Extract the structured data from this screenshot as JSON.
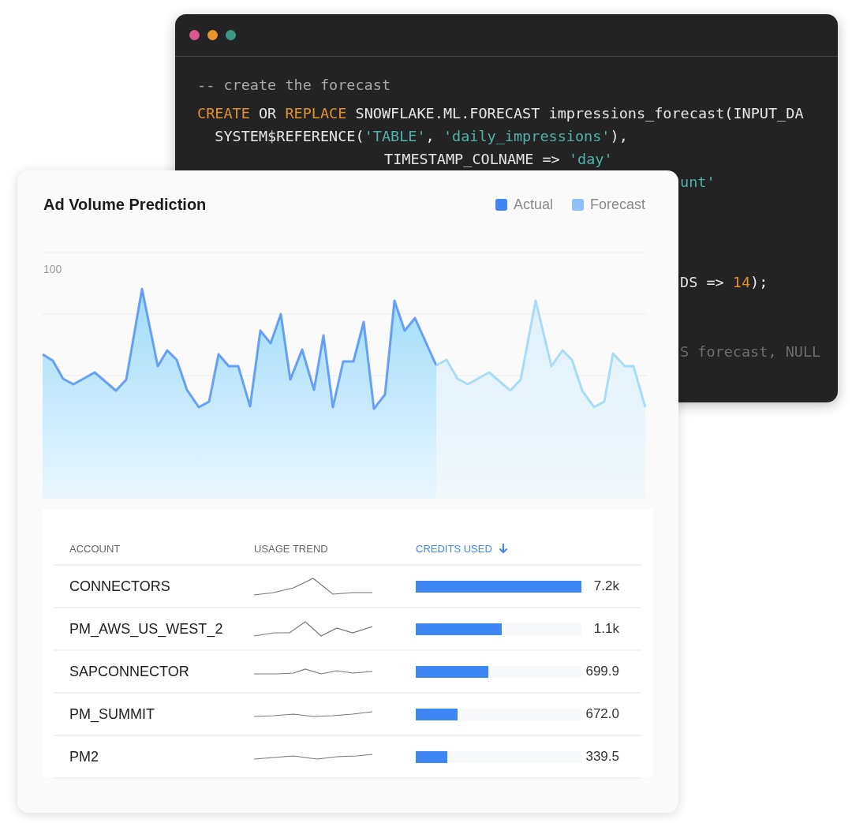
{
  "code_window": {
    "lines": [
      {
        "segments": [
          {
            "kind": "comment",
            "text": "-- create the forecast"
          }
        ]
      },
      {
        "segments": [
          {
            "kind": "keyword",
            "text": "CREATE"
          },
          {
            "kind": "plain",
            "text": " OR "
          },
          {
            "kind": "keyword",
            "text": "REPLACE"
          },
          {
            "kind": "plain",
            "text": " SNOWFLAKE.ML.FORECAST impressions_forecast(INPUT_DA"
          }
        ]
      },
      {
        "segments": [
          {
            "kind": "plain",
            "text": "  SYSTEM$REFERENCE("
          },
          {
            "kind": "string",
            "text": "'TABLE'"
          },
          {
            "kind": "plain",
            "text": ", "
          },
          {
            "kind": "string",
            "text": "'daily_impressions'"
          },
          {
            "kind": "plain",
            "text": "),"
          }
        ]
      },
      {
        "segments": [
          {
            "kind": "plain",
            "text": "TIMESTAMP_COLNAME => "
          },
          {
            "kind": "string",
            "text": "'day'"
          }
        ]
      },
      {
        "segments": [
          {
            "kind": "string",
            "text": "unt'"
          }
        ]
      },
      {
        "segments": [
          {
            "kind": "plain",
            "text": "DS => "
          },
          {
            "kind": "number",
            "text": "14"
          },
          {
            "kind": "plain",
            "text": ");"
          }
        ]
      },
      {
        "segments": [
          {
            "kind": "faded",
            "text": "S forecast, NULL"
          }
        ]
      }
    ]
  },
  "card": {
    "title": "Ad Volume Prediction",
    "legend": [
      {
        "label": "Actual",
        "color": "#3f86f5"
      },
      {
        "label": "Forecast",
        "color": "#8fc0fa"
      }
    ],
    "y_label": "100",
    "table": {
      "columns": [
        {
          "label": "ACCOUNT",
          "sorted": false
        },
        {
          "label": "USAGE TREND",
          "sorted": false
        },
        {
          "label": "CREDITS USED",
          "sorted": true
        }
      ],
      "rows": [
        {
          "account": "CONNECTORS",
          "level": 1,
          "credits": "7.2k"
        },
        {
          "account": "PM_AWS_US_WEST_2",
          "level": 0.52,
          "credits": "1.1k"
        },
        {
          "account": "SAPCONNECTOR",
          "level": 0.44,
          "credits": "699.9"
        },
        {
          "account": "PM_SUMMIT",
          "level": 0.25,
          "credits": "672.0"
        },
        {
          "account": "PM2",
          "level": 0.19,
          "credits": "339.5"
        }
      ]
    }
  }
}
